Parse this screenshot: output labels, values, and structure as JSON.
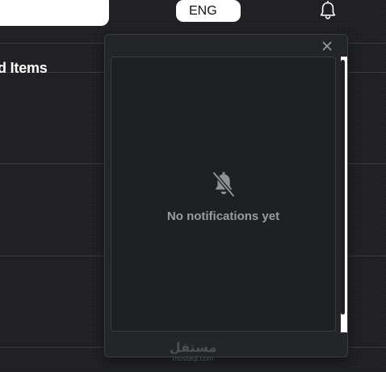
{
  "header": {
    "language_select": {
      "selected": "ENG",
      "caret_icon": "chevron-down-icon"
    },
    "notification_icon": "bell-icon"
  },
  "main": {
    "section_title": "d Items"
  },
  "notifications_popup": {
    "close_icon": "close-icon",
    "empty_icon": "bell-off-icon",
    "empty_text": "No notifications yet"
  },
  "watermark": {
    "arabic": "مستقل",
    "latin": "mostaql.com"
  },
  "colors": {
    "background": "#1f2023",
    "popup_background": "#232528",
    "muted_text": "#9a9ca0",
    "divider": "#3a3c40"
  }
}
